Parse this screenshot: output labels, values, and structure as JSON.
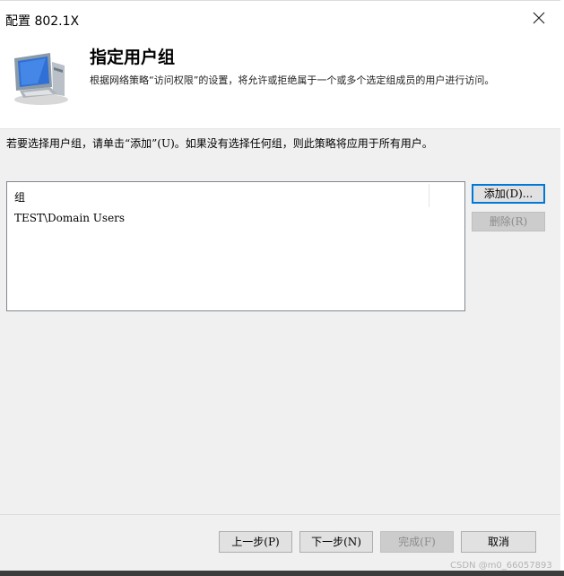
{
  "window": {
    "title": "配置 802.1X",
    "close_icon": "close-icon"
  },
  "header": {
    "title": "指定用户组",
    "description": "根据网络策略“访问权限”的设置，将允许或拒绝属于一个或多个选定组成员的用户进行访问。",
    "icon": "network-computer-icon"
  },
  "instruction": "若要选择用户组，请单击“添加”(U)。如果没有选择任何组，则此策略将应用于所有用户。",
  "groups": {
    "column_header": "组",
    "items": [
      "TEST\\Domain Users"
    ]
  },
  "side_buttons": {
    "add_label": "添加(D)...",
    "delete_label": "删除(R)"
  },
  "footer": {
    "prev_label": "上一步(P)",
    "next_label": "下一步(N)",
    "finish_label": "完成(F)",
    "cancel_label": "取消"
  },
  "watermark": "CSDN @m0_66057893",
  "colors": {
    "accent": "#0078d7",
    "dialog_bg": "#f0f0f0",
    "disabled_text": "#8c8c8c"
  }
}
